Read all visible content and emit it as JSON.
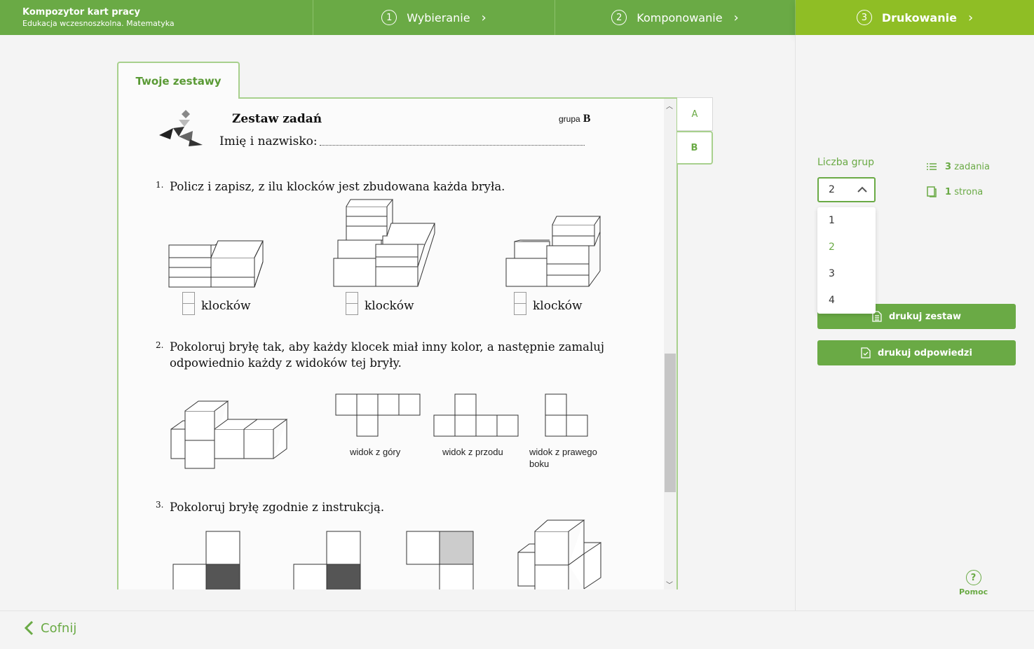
{
  "header": {
    "app_title": "Kompozytor kart pracy",
    "app_subtitle": "Edukacja wczesnoszkolna. Matematyka",
    "steps": [
      {
        "num": "1",
        "label": "Wybieranie"
      },
      {
        "num": "2",
        "label": "Komponowanie"
      },
      {
        "num": "3",
        "label": "Drukowanie"
      }
    ]
  },
  "document": {
    "tab_label": "Twoje zestawy",
    "group_tabs": [
      "A",
      "B"
    ],
    "active_group": "B",
    "title": "Zestaw zadań",
    "group_label": "grupa",
    "group_value": "B",
    "name_label": "Imię i nazwisko:",
    "tasks": [
      {
        "num": "1.",
        "text": "Policz i zapisz, z ilu klocków jest zbudowana każda bryła.",
        "answer_label": "klocków"
      },
      {
        "num": "2.",
        "text_line1": "Pokoloruj bryłę tak, aby każdy klocek miał inny kolor, a następnie zamaluj",
        "text_line2": "odpowiednio każdy z widoków tej bryły.",
        "captions": [
          "widok z góry",
          "widok z przodu",
          "widok z prawego",
          "boku"
        ]
      },
      {
        "num": "3.",
        "text": "Pokoloruj bryłę zgodnie z instrukcją."
      }
    ]
  },
  "panel": {
    "groups_label": "Liczba grup",
    "groups_selected": "2",
    "groups_options": [
      "1",
      "2",
      "3",
      "4"
    ],
    "tasks_count": "3",
    "tasks_word": "zadania",
    "pages_count": "1",
    "pages_word": "strona",
    "print_set": "drukuj zestaw",
    "print_answers": "drukuj odpowiedzi",
    "help": "Pomoc",
    "help_symbol": "?"
  },
  "footer": {
    "back": "Cofnij"
  },
  "colors": {
    "primary": "#6aaa45",
    "active_step": "#8fbe25",
    "tab_border": "#a8d08d"
  }
}
